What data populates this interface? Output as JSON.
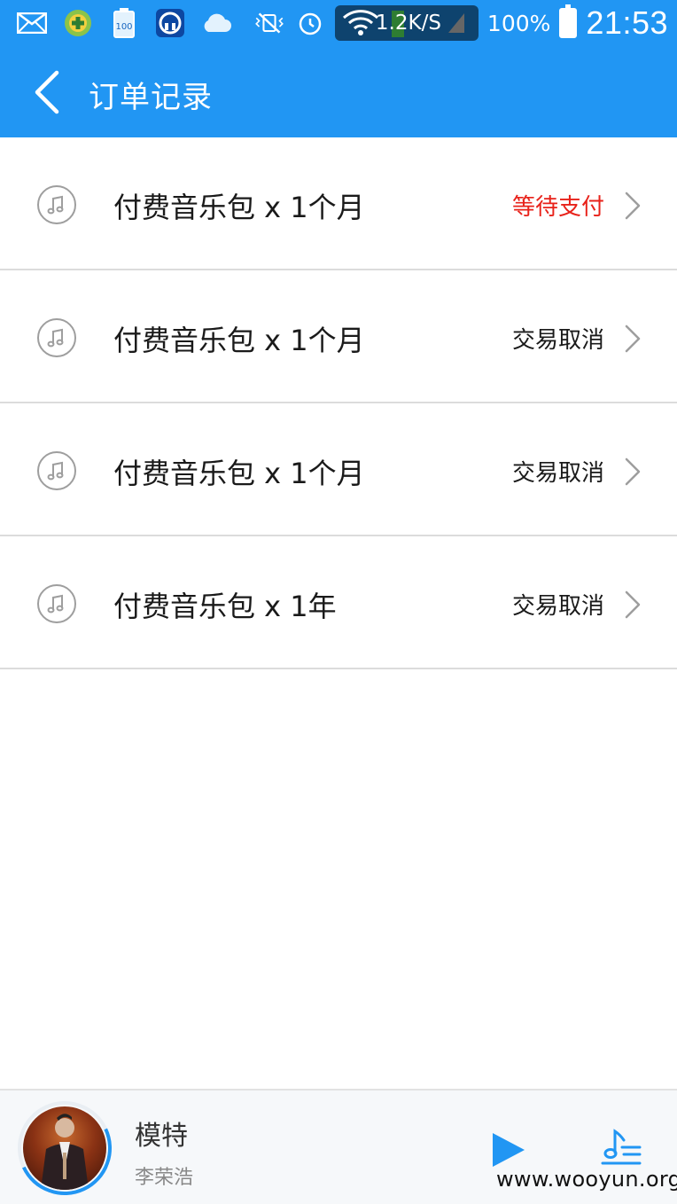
{
  "status_bar": {
    "network_speed": "1.2K/S",
    "battery_percent": "100%",
    "time": "21:53",
    "icons": [
      "mail-icon",
      "plus-app-icon",
      "battery-100-app-icon",
      "headset-app-icon",
      "cloud-icon",
      "vibrate-mute-icon",
      "alarm-icon",
      "wifi-icon",
      "signal-icon",
      "battery-icon"
    ],
    "bar_color": "#2196f3"
  },
  "header": {
    "title": "订单记录",
    "back_icon": "chevron-left-icon"
  },
  "orders": [
    {
      "name": "付费音乐包 x 1个月",
      "status": "等待支付",
      "status_color": "#e8221a",
      "icon": "music-note-icon"
    },
    {
      "name": "付费音乐包 x 1个月",
      "status": "交易取消",
      "status_color": "#1a1a1a",
      "icon": "music-note-icon"
    },
    {
      "name": "付费音乐包 x 1个月",
      "status": "交易取消",
      "status_color": "#1a1a1a",
      "icon": "music-note-icon"
    },
    {
      "name": "付费音乐包 x 1年",
      "status": "交易取消",
      "status_color": "#1a1a1a",
      "icon": "music-note-icon"
    }
  ],
  "player": {
    "song_title": "模特",
    "artist": "李荣浩",
    "play_icon": "play-icon",
    "playlist_icon": "playlist-icon",
    "accent_color": "#2196f3"
  },
  "watermark": "www.wooyun.org"
}
